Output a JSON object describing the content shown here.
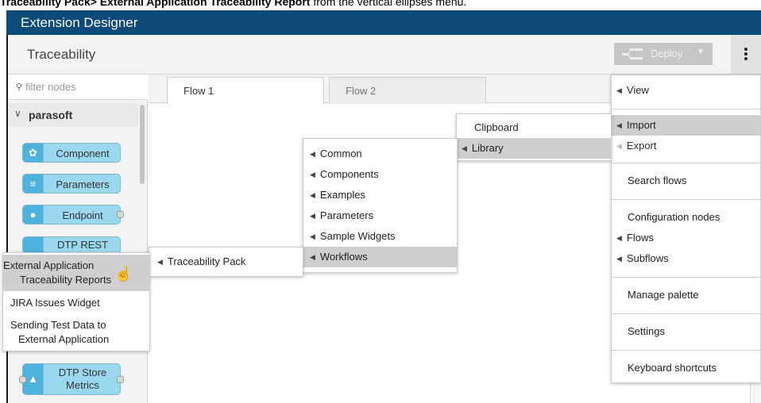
{
  "caption": {
    "bold": "Traceability Pack> External Application Traceability Report",
    "rest": " from the vertical ellipses menu."
  },
  "app": {
    "title": "Extension Designer"
  },
  "header": {
    "title": "Traceability",
    "deploy_label": "Deploy"
  },
  "sidebar": {
    "filter_placeholder": "filter nodes",
    "category": "parasoft",
    "nodes": [
      "Component",
      "Parameters",
      "Endpoint",
      "DTP REST",
      "DTP Store Metrics"
    ]
  },
  "tabs": [
    "Flow 1",
    "Flow 2"
  ],
  "main_menu": {
    "items": [
      "View",
      "Import",
      "Export",
      "Search flows",
      "Configuration nodes",
      "Flows",
      "Subflows",
      "Manage palette",
      "Settings",
      "Keyboard shortcuts"
    ],
    "highlighted": "Import"
  },
  "import_menu": {
    "items": [
      "Clipboard",
      "Library"
    ],
    "highlighted": "Library"
  },
  "library_menu": {
    "items": [
      "Common",
      "Components",
      "Examples",
      "Parameters",
      "Sample Widgets",
      "Workflows"
    ],
    "highlighted": "Workflows"
  },
  "workflows_menu": {
    "items": [
      "Traceability Pack"
    ]
  },
  "traceability_menu": {
    "items": [
      "External Application Traceability Reports",
      "JIRA Issues Widget",
      "Sending Test Data to External Application"
    ],
    "item1_lines": [
      "External Application",
      "Traceability Reports"
    ],
    "item3_lines": [
      "Sending Test Data to",
      "External Application"
    ],
    "highlighted": "External Application Traceability Reports"
  },
  "colors": {
    "topbar": "#0c4a7a",
    "node_fill": "#9ad8ef",
    "node_icon": "#4eb3dc",
    "menu_highlight": "#cfcfcf"
  },
  "icons": [
    "search-icon",
    "chevron-down-icon",
    "deploy-icon",
    "kebab-icon",
    "caret-left-icon",
    "hand-pointer-icon"
  ]
}
